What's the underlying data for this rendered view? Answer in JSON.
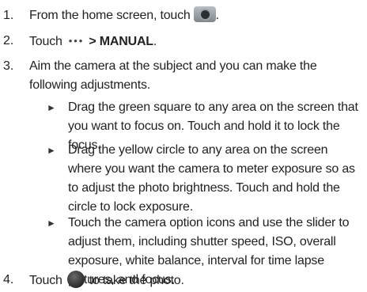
{
  "steps": [
    {
      "num": "1.",
      "before": "From the home screen, touch",
      "after": ".",
      "icon": "camera-app-icon"
    },
    {
      "num": "2.",
      "before": "Touch",
      "bold": "> MANUAL",
      "after": ".",
      "icon": "more-options-icon",
      "icon_text": "•••"
    },
    {
      "num": "3.",
      "text": "Aim the camera at the subject and you can make the following adjustments."
    },
    {
      "num": "4.",
      "before": "Touch",
      "after": "to take the photo.",
      "icon": "shutter-button-icon"
    }
  ],
  "bullets": [
    {
      "marker": "►",
      "text": "Drag the green square to any area on the screen that you want to focus on. Touch and hold it to lock the focus."
    },
    {
      "marker": "►",
      "text": "Drag the yellow circle to any area on the screen where you want the camera to meter exposure so as to adjust the photo brightness. Touch and hold the circle to lock exposure."
    },
    {
      "marker": "►",
      "text": "Touch the camera option icons and use the slider to adjust them, including shutter speed, ISO, overall exposure, white balance, interval for time lapse pictures, and focus."
    }
  ]
}
